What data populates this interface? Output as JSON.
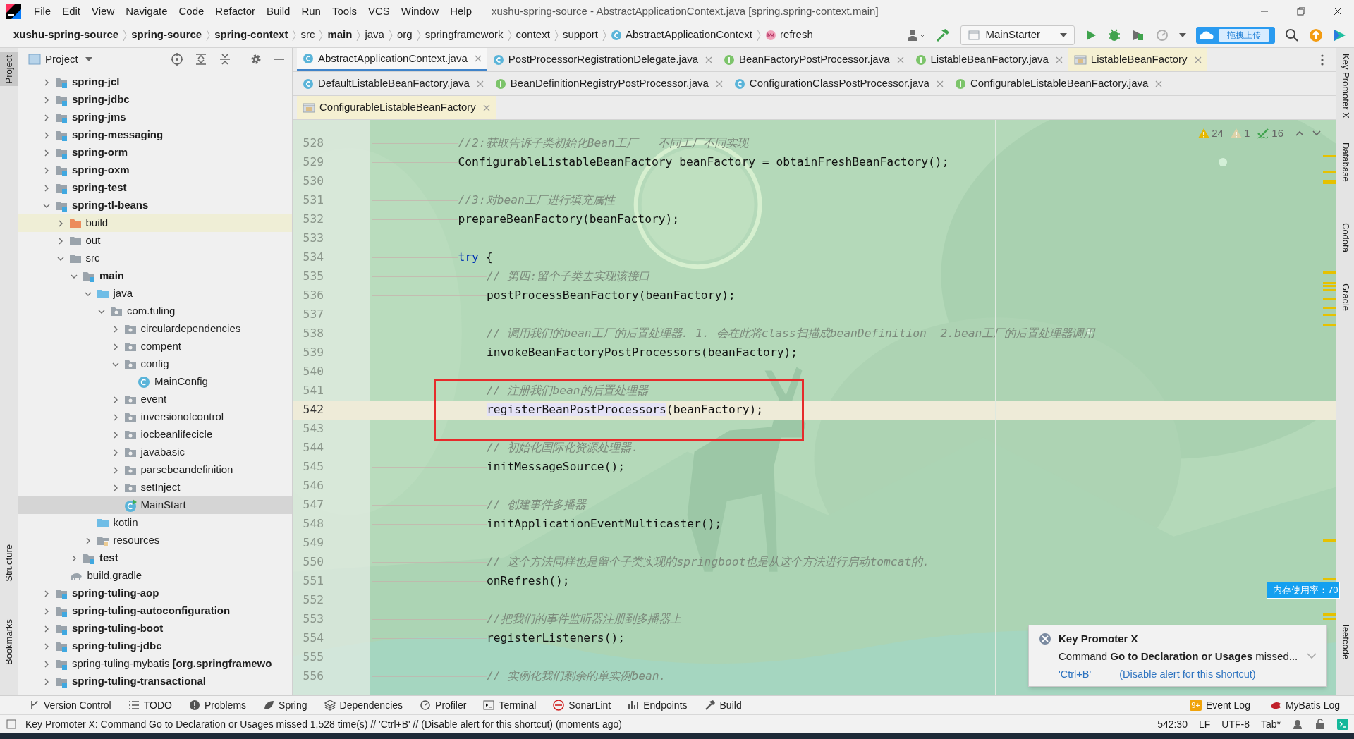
{
  "window": {
    "title": "xushu-spring-source - AbstractApplicationContext.java [spring.spring-context.main]"
  },
  "menu": [
    "File",
    "Edit",
    "View",
    "Navigate",
    "Code",
    "Refactor",
    "Build",
    "Run",
    "Tools",
    "VCS",
    "Window",
    "Help"
  ],
  "breadcrumbs": [
    {
      "label": "xushu-spring-source",
      "kind": "project"
    },
    {
      "label": "spring-source",
      "kind": "project"
    },
    {
      "label": "spring-context",
      "kind": "project"
    },
    {
      "label": "src",
      "kind": "folder"
    },
    {
      "label": "main",
      "kind": "project"
    },
    {
      "label": "java",
      "kind": "folder"
    },
    {
      "label": "org",
      "kind": "folder"
    },
    {
      "label": "springframework",
      "kind": "folder"
    },
    {
      "label": "context",
      "kind": "folder"
    },
    {
      "label": "support",
      "kind": "folder"
    },
    {
      "label": "AbstractApplicationContext",
      "kind": "class"
    },
    {
      "label": "refresh",
      "kind": "method"
    }
  ],
  "toolbar": {
    "run_configuration": "MainStarter",
    "upload_badge": "拖拽上传"
  },
  "project_panel": {
    "title": "Project",
    "tree": [
      {
        "label": "spring-jcl",
        "kind": "module",
        "expanded": false,
        "selected": false
      },
      {
        "label": "spring-jdbc",
        "kind": "module",
        "expanded": false,
        "selected": false
      },
      {
        "label": "spring-jms",
        "kind": "module",
        "expanded": false,
        "selected": false
      },
      {
        "label": "spring-messaging",
        "kind": "module",
        "expanded": false,
        "selected": false
      },
      {
        "label": "spring-orm",
        "kind": "module",
        "expanded": false,
        "selected": false
      },
      {
        "label": "spring-oxm",
        "kind": "module",
        "expanded": false,
        "selected": false
      },
      {
        "label": "spring-test",
        "kind": "module",
        "expanded": false,
        "selected": false
      },
      {
        "label": "spring-tl-beans",
        "kind": "module",
        "expanded": true,
        "selected": false,
        "children": [
          {
            "label": "build",
            "kind": "excluded",
            "expanded": false,
            "selected": false
          },
          {
            "label": "out",
            "kind": "folder",
            "expanded": false,
            "selected": false
          },
          {
            "label": "src",
            "kind": "folder",
            "expanded": true,
            "selected": false,
            "children": [
              {
                "label": "main",
                "kind": "module",
                "expanded": true,
                "selected": false,
                "children": [
                  {
                    "label": "java",
                    "kind": "source",
                    "expanded": true,
                    "selected": false,
                    "children": [
                      {
                        "label": "com.tuling",
                        "kind": "package",
                        "expanded": true,
                        "selected": false,
                        "children": [
                          {
                            "label": "circulardependencies",
                            "kind": "package",
                            "expanded": false,
                            "selected": false
                          },
                          {
                            "label": "compent",
                            "kind": "package",
                            "expanded": false,
                            "selected": false
                          },
                          {
                            "label": "config",
                            "kind": "package",
                            "expanded": true,
                            "selected": false,
                            "children": [
                              {
                                "label": "MainConfig",
                                "kind": "class",
                                "selected": false
                              }
                            ]
                          },
                          {
                            "label": "event",
                            "kind": "package",
                            "expanded": false,
                            "selected": false
                          },
                          {
                            "label": "inversionofcontrol",
                            "kind": "package",
                            "expanded": false,
                            "selected": false
                          },
                          {
                            "label": "iocbeanlifecicle",
                            "kind": "package",
                            "expanded": false,
                            "selected": false
                          },
                          {
                            "label": "javabasic",
                            "kind": "package",
                            "expanded": false,
                            "selected": false
                          },
                          {
                            "label": "parsebeandefinition",
                            "kind": "package",
                            "expanded": false,
                            "selected": false
                          },
                          {
                            "label": "setInject",
                            "kind": "package",
                            "expanded": false,
                            "selected": false
                          },
                          {
                            "label": "MainStart",
                            "kind": "main_class",
                            "selected": true
                          }
                        ]
                      }
                    ]
                  },
                  {
                    "label": "kotlin",
                    "kind": "source",
                    "selected": false
                  },
                  {
                    "label": "resources",
                    "kind": "resources",
                    "expanded": false,
                    "selected": false
                  }
                ]
              },
              {
                "label": "test",
                "kind": "module",
                "expanded": false,
                "selected": false
              }
            ]
          },
          {
            "label": "build.gradle",
            "kind": "gradle",
            "selected": false
          }
        ]
      },
      {
        "label": "spring-tuling-aop",
        "kind": "module",
        "expanded": false,
        "selected": false
      },
      {
        "label": "spring-tuling-autoconfiguration",
        "kind": "module",
        "expanded": false,
        "selected": false
      },
      {
        "label": "spring-tuling-boot",
        "kind": "module",
        "expanded": false,
        "selected": false
      },
      {
        "label": "spring-tuling-jdbc",
        "kind": "module",
        "expanded": false,
        "selected": false
      },
      {
        "label": "spring-tuling-mybatis **[org.springframewo**",
        "kind": "plain_module",
        "expanded": false,
        "selected": false
      },
      {
        "label": "spring-tuling-transactional",
        "kind": "module",
        "expanded": false,
        "selected": false
      }
    ]
  },
  "tab_rows": [
    [
      {
        "label": "AbstractApplicationContext.java",
        "kind": "class",
        "selected": true
      },
      {
        "label": "PostProcessorRegistrationDelegate.java",
        "kind": "class",
        "selected": false
      },
      {
        "label": "BeanFactoryPostProcessor.java",
        "kind": "interface",
        "selected": false
      },
      {
        "label": "ListableBeanFactory.java",
        "kind": "interface",
        "selected": false
      },
      {
        "label": "ListableBeanFactory",
        "kind": "library",
        "selected": false
      }
    ],
    [
      {
        "label": "DefaultListableBeanFactory.java",
        "kind": "class",
        "selected": false
      },
      {
        "label": "BeanDefinitionRegistryPostProcessor.java",
        "kind": "interface",
        "selected": false
      },
      {
        "label": "ConfigurationClassPostProcessor.java",
        "kind": "class",
        "selected": false
      },
      {
        "label": "ConfigurableListableBeanFactory.java",
        "kind": "interface",
        "selected": false
      }
    ],
    [
      {
        "label": "ConfigurableListableBeanFactory",
        "kind": "library",
        "selected": false
      }
    ]
  ],
  "editor": {
    "inspections": {
      "warnings": "24",
      "weak_warnings": "1",
      "typos": "16"
    },
    "lines": [
      {
        "number": "528",
        "kind": "comment",
        "text": "//2:获取告诉子类初始化Bean工厂   不同工厂不同实现",
        "current": false,
        "marked": false
      },
      {
        "number": "529",
        "kind": "code",
        "text": "ConfigurableListableBeanFactory beanFactory = obtainFreshBeanFactory();",
        "current": false,
        "marked": false
      },
      {
        "number": "530",
        "kind": "blank",
        "current": false,
        "marked": false
      },
      {
        "number": "531",
        "kind": "comment",
        "text": "//3:对bean工厂进行填充属性",
        "current": false,
        "marked": false
      },
      {
        "number": "532",
        "kind": "code",
        "text": "prepareBeanFactory(beanFactory);",
        "current": false,
        "marked": false
      },
      {
        "number": "533",
        "kind": "blank",
        "current": false,
        "marked": false
      },
      {
        "number": "534",
        "kind": "code",
        "keyword": "try",
        "text": " {",
        "current": false,
        "marked": false,
        "children": [
          {
            "number": "535",
            "kind": "comment",
            "text": "// 第四:留个子类去实现该接口",
            "current": false,
            "marked": false
          },
          {
            "number": "536",
            "kind": "code",
            "text": "postProcessBeanFactory(beanFactory);",
            "current": false,
            "marked": false
          },
          {
            "number": "537",
            "kind": "blank",
            "current": false,
            "marked": false
          },
          {
            "number": "538",
            "kind": "comment",
            "text": "// 调用我们的bean工厂的后置处理器. 1. 会在此将class扫描成beanDefinition  2.bean工厂的后置处理器调用",
            "current": false,
            "marked": false
          },
          {
            "number": "539",
            "kind": "code",
            "text": "invokeBeanFactoryPostProcessors(beanFactory);",
            "current": false,
            "marked": false
          },
          {
            "number": "540",
            "kind": "blank",
            "current": false,
            "marked": false
          },
          {
            "number": "541",
            "kind": "comment",
            "text": "// 注册我们bean的后置处理器",
            "current": false,
            "marked": true
          },
          {
            "number": "542",
            "kind": "code",
            "highlight": "registerBeanPostProcessors",
            "text": "(beanFactory);",
            "current": true,
            "marked": true
          },
          {
            "number": "543",
            "kind": "blank",
            "current": false,
            "marked": true
          },
          {
            "number": "544",
            "kind": "comment",
            "text": "// 初始化国际化资源处理器.",
            "current": false,
            "marked": false
          },
          {
            "number": "545",
            "kind": "code",
            "text": "initMessageSource();",
            "current": false,
            "marked": false
          },
          {
            "number": "546",
            "kind": "blank",
            "current": false,
            "marked": false
          },
          {
            "number": "547",
            "kind": "comment",
            "text": "// 创建事件多播器",
            "current": false,
            "marked": false
          },
          {
            "number": "548",
            "kind": "code",
            "text": "initApplicationEventMulticaster();",
            "current": false,
            "marked": false
          },
          {
            "number": "549",
            "kind": "blank",
            "current": false,
            "marked": false
          },
          {
            "number": "550",
            "kind": "comment",
            "text": "// 这个方法同样也是留个子类实现的springboot也是从这个方法进行启动tomcat的.",
            "current": false,
            "marked": false
          },
          {
            "number": "551",
            "kind": "code",
            "text": "onRefresh();",
            "current": false,
            "marked": false
          },
          {
            "number": "552",
            "kind": "blank",
            "current": false,
            "marked": false
          },
          {
            "number": "553",
            "kind": "comment",
            "text": "//把我们的事件监听器注册到多播器上",
            "current": false,
            "marked": false
          },
          {
            "number": "554",
            "kind": "code",
            "text": "registerListeners();",
            "current": false,
            "marked": false
          },
          {
            "number": "555",
            "kind": "blank",
            "current": false,
            "marked": false
          },
          {
            "number": "556",
            "kind": "comment",
            "text": "// 实例化我们剩余的单实例bean.",
            "current": false,
            "marked": false
          }
        ]
      }
    ]
  },
  "notification": {
    "title": "Key Promoter X",
    "message": "Command **Go to Declaration or Usages** missed...",
    "shortcut": "'Ctrl+B'",
    "action": "(Disable alert for this shortcut)"
  },
  "memory_badge": "内存使用率：70",
  "left_stripe": [
    {
      "label": "Project",
      "selected": true
    },
    {
      "label": "Structure",
      "selected": false
    },
    {
      "label": "Bookmarks",
      "selected": false
    }
  ],
  "right_stripe": [
    {
      "label": "Key Promoter X",
      "selected": false
    },
    {
      "label": "Database",
      "selected": false
    },
    {
      "label": "Codota",
      "selected": false
    },
    {
      "label": "Gradle",
      "selected": false
    },
    {
      "label": "leetcode",
      "selected": false
    }
  ],
  "tool_windows": [
    {
      "label": "Version Control",
      "kind": "vcs"
    },
    {
      "label": "TODO",
      "kind": "todo"
    },
    {
      "label": "Problems",
      "kind": "problems"
    },
    {
      "label": "Spring",
      "kind": "spring"
    },
    {
      "label": "Dependencies",
      "kind": "dependencies"
    },
    {
      "label": "Profiler",
      "kind": "profiler"
    },
    {
      "label": "Terminal",
      "kind": "terminal"
    },
    {
      "label": "SonarLint",
      "kind": "sonar"
    },
    {
      "label": "Endpoints",
      "kind": "endpoints"
    },
    {
      "label": "Build",
      "kind": "build"
    }
  ],
  "tool_windows_right": [
    {
      "label": "Event Log",
      "kind": "eventlog",
      "badge": "9+"
    },
    {
      "label": "MyBatis Log",
      "kind": "mybatis"
    }
  ],
  "status_bar": {
    "message": "Key Promoter X: Command Go to Declaration or Usages missed 1,528 time(s) // 'Ctrl+B' // (Disable alert for this shortcut) (moments ago)",
    "position": "542:30",
    "line_separator": "LF",
    "encoding": "UTF-8",
    "indent": "Tab*"
  }
}
